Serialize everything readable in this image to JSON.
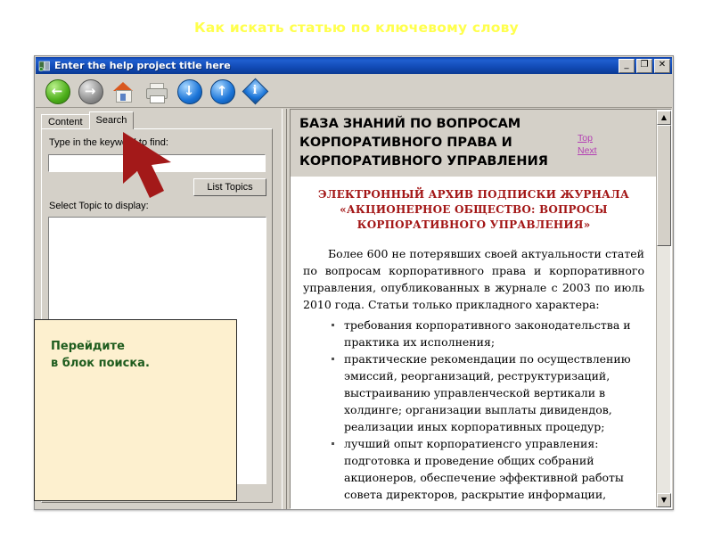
{
  "slide": {
    "title": "Как искать статью по ключевому слову",
    "title_color": "#ffff4d",
    "background": "#ffffff"
  },
  "window": {
    "title": "Enter the help project title here",
    "titlebar_color": "#1149b4",
    "icon": "help-book-icon",
    "controls": {
      "minimize": "_",
      "maximize": "❐",
      "close": "✕"
    }
  },
  "toolbar": {
    "buttons": [
      {
        "name": "back-button",
        "icon": "arrow-left-circle-green",
        "glyph": "←",
        "color": "#4cae1a"
      },
      {
        "name": "forward-button",
        "icon": "arrow-right-circle-gray",
        "glyph": "→",
        "color": "#8f8f8f"
      },
      {
        "name": "home-button",
        "icon": "home-icon",
        "glyph": "",
        "color": "#d9581f"
      },
      {
        "name": "print-button",
        "icon": "printer-icon",
        "glyph": "",
        "color": "#cfcec8"
      },
      {
        "name": "down-button",
        "icon": "arrow-down-circle-blue",
        "glyph": "↓",
        "color": "#1a74d8"
      },
      {
        "name": "up-button",
        "icon": "arrow-up-circle-blue",
        "glyph": "↑",
        "color": "#1a74d8"
      },
      {
        "name": "info-button",
        "icon": "info-diamond-icon",
        "glyph": "i",
        "color": "#1a74d8"
      }
    ]
  },
  "left_pane": {
    "tabs": [
      {
        "label": "Content",
        "active": false
      },
      {
        "label": "Search",
        "active": true
      }
    ],
    "keyword_label": "Type in the keyword to find:",
    "keyword_value": "",
    "keyword_placeholder": "",
    "list_topics_label": "List Topics",
    "select_topic_label": "Select Topic to display:",
    "topic_items": []
  },
  "content": {
    "header_title": "БАЗА ЗНАНИЙ ПО ВОПРОСАМ КОРПОРАТИВНОГО ПРАВА И КОРПОРАТИВНОГО УПРАВЛЕНИЯ",
    "nav_links": [
      {
        "label": "Top"
      },
      {
        "label": "Next"
      }
    ],
    "link_color": "#b33fb3",
    "subtitle": "ЭЛЕКТРОННЫЙ АРХИВ ПОДПИСКИ ЖУРНАЛА «АКЦИОНЕРНОЕ ОБЩЕСТВО: ВОПРОСЫ КОРПОРАТИВНОГО УПРАВЛЕНИЯ»",
    "subtitle_color": "#a31616",
    "paragraph": "Более 600 не потерявших своей актуальности статей по вопросам корпоративного права и корпоративного управления, опубликованных в журнале с 2003 по июль 2010 года. Статьи только прикладного характера:",
    "bullets": [
      "требования корпоративного законодательства и практика их исполнения;",
      "практические рекомендации по осуществлению эмиссий, реорганизаций, реструктуризаций, выстраиванию управленческой вертикали в холдинге; организации выплаты дивидендов, реализации иных корпоративных процедур;",
      "лучший опыт корпоратиенсго управления: подготовка и проведение общих собраний акционеров, обеспечение эффективной работы совета директоров, раскрытие информации, ведение реестра акционеров, защита прав акционеров, внутренний контроль и"
    ]
  },
  "scrollbar": {
    "up_glyph": "▲",
    "down_glyph": "▼"
  },
  "callout": {
    "text": "Перейдите\nв блок поиска.",
    "text_color": "#1e5c1e",
    "background": "#fdf0cf"
  },
  "cursor": {
    "name": "red-arrow-pointer",
    "color": "#a31919"
  }
}
